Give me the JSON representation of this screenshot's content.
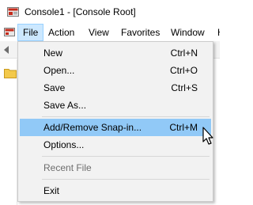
{
  "window": {
    "title": "Console1 - [Console Root]"
  },
  "menubar": {
    "items": [
      {
        "label": "File"
      },
      {
        "label": "Action"
      },
      {
        "label": "View"
      },
      {
        "label": "Favorites"
      },
      {
        "label": "Window"
      },
      {
        "label": "H"
      }
    ]
  },
  "file_menu": {
    "items": [
      {
        "label": "New",
        "shortcut": "Ctrl+N"
      },
      {
        "label": "Open...",
        "shortcut": "Ctrl+O"
      },
      {
        "label": "Save",
        "shortcut": "Ctrl+S"
      },
      {
        "label": "Save As...",
        "shortcut": ""
      },
      {
        "label": "Add/Remove Snap-in...",
        "shortcut": "Ctrl+M"
      },
      {
        "label": "Options...",
        "shortcut": ""
      },
      {
        "label": "Recent File",
        "shortcut": ""
      },
      {
        "label": "Exit",
        "shortcut": ""
      }
    ],
    "highlighted": "Add/Remove Snap-in...",
    "disabled": "Recent File"
  },
  "colors": {
    "menu_highlight": "#91c9f7",
    "menubar_active": "#cce8ff",
    "app_icon_red": "#c42b1c"
  },
  "icons": {
    "app": "console-app-icon",
    "system": "system-menu-icon",
    "back": "back-arrow-icon",
    "folder": "folder-icon",
    "cursor": "mouse-pointer-icon"
  }
}
